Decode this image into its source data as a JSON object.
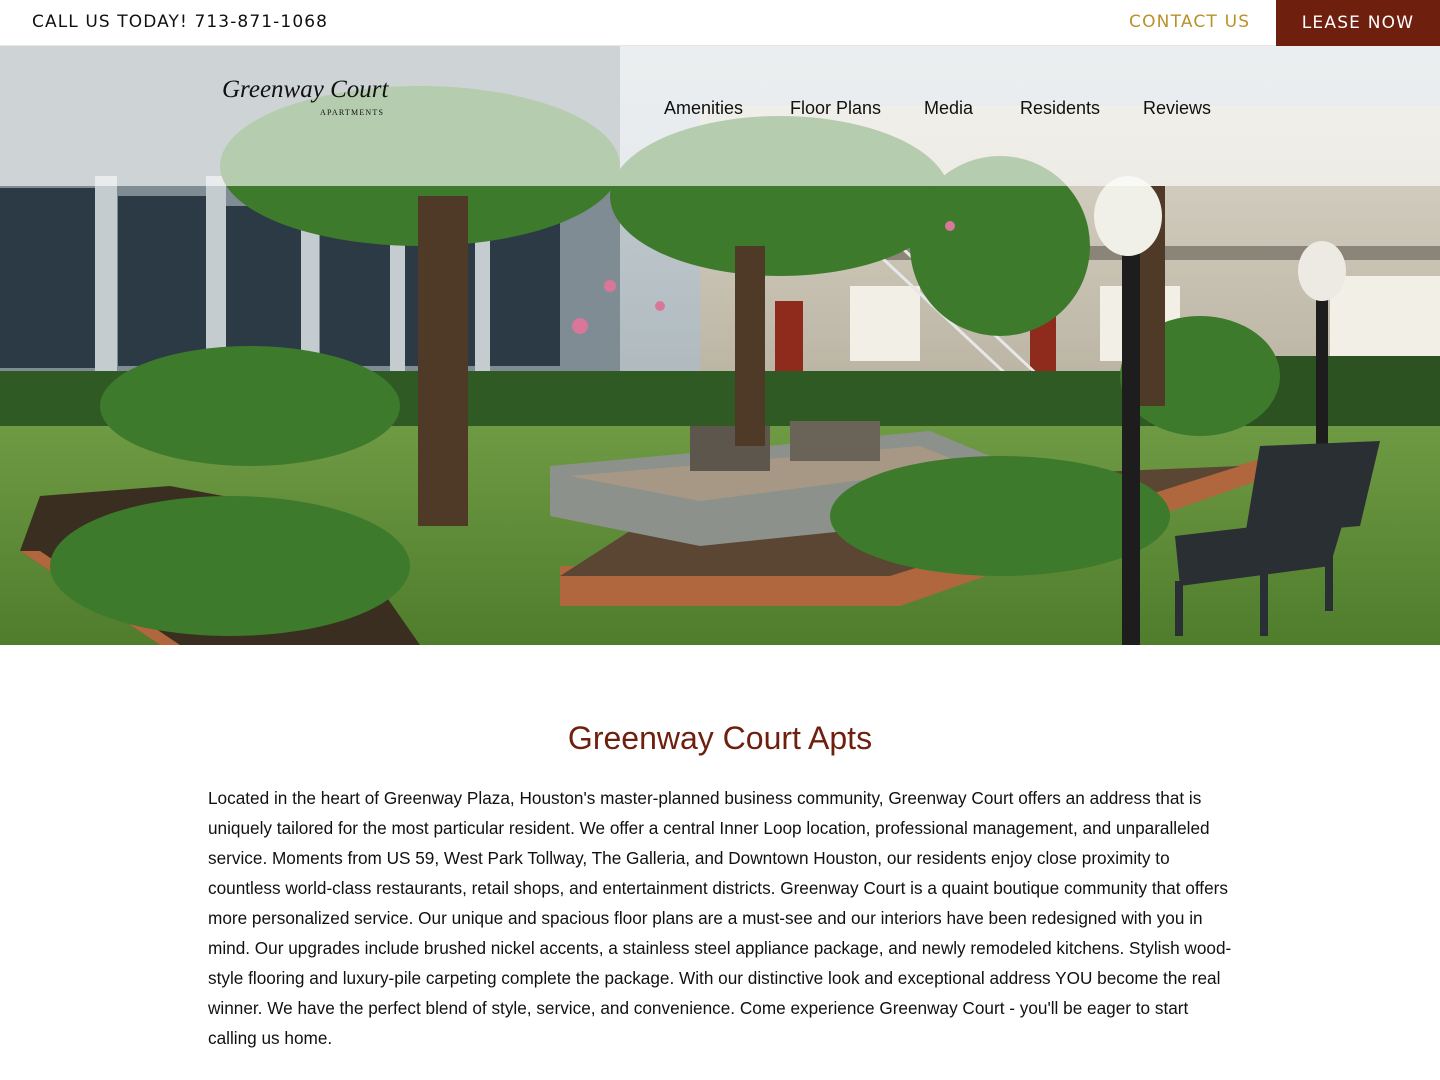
{
  "topbar": {
    "call_text": "CALL US TODAY! 713-871-1068",
    "contact_label": "CONTACT US",
    "lease_label": "LEASE NOW",
    "lease_bg": "#6e1f0d",
    "contact_color": "#b8922a"
  },
  "logo": {
    "main": "Greenway Court",
    "sub": "APARTMENTS"
  },
  "nav": {
    "items": [
      "Amenities",
      "Floor Plans",
      "Media",
      "Residents",
      "Reviews"
    ]
  },
  "content": {
    "title": "Greenway Court Apts",
    "title_color": "#6e1f0d",
    "body": "Located in the heart of Greenway Plaza, Houston's master-planned business community, Greenway Court offers an address that is uniquely tailored for the most particular resident. We offer a central Inner Loop location, professional management, and unparalleled service. Moments from US 59, West Park Tollway, The Galleria, and Downtown Houston, our residents enjoy close proximity to countless world-class restaurants, retail shops, and entertainment districts. Greenway Court is a quaint boutique community that offers more personalized service. Our unique and spacious floor plans are a must-see and our interiors have been redesigned with you in mind. Our upgrades include brushed nickel accents, a stainless steel appliance package, and newly remodeled kitchens. Stylish wood-style flooring and luxury-pile carpeting complete the package. With our distinctive look and exceptional address YOU become the real winner. We have the perfect blend of style, service, and convenience. Come experience Greenway Court - you'll be eager to start calling us home."
  }
}
